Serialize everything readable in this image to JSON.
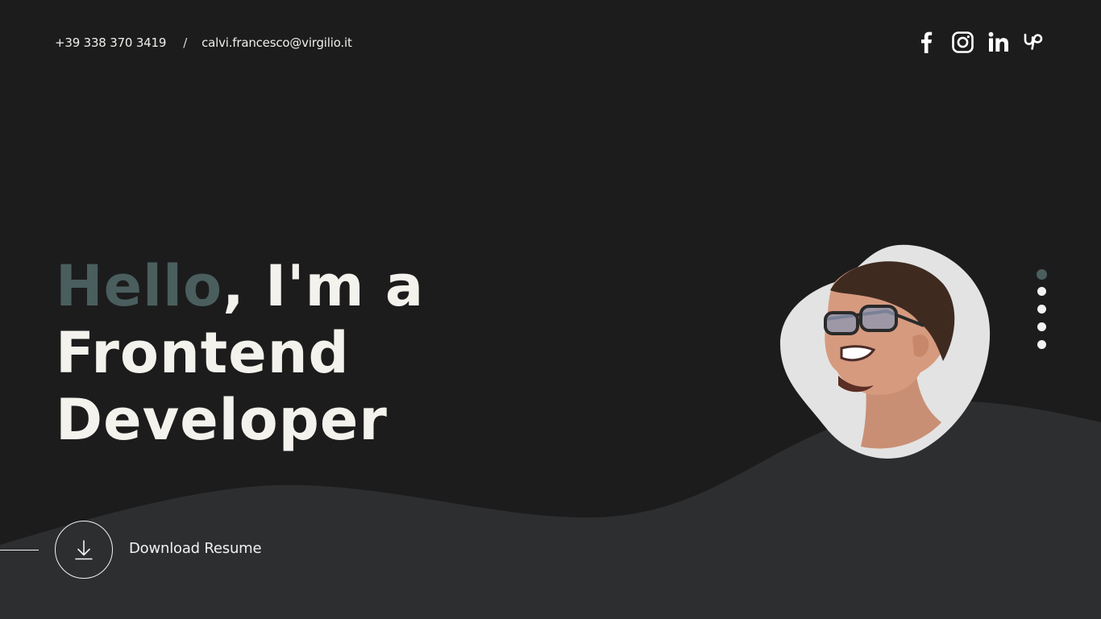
{
  "contact": {
    "phone": "+39 338 370 3419",
    "separator": "/",
    "email": "calvi.francesco@virgilio.it"
  },
  "social": [
    {
      "name": "facebook-icon"
    },
    {
      "name": "instagram-icon"
    },
    {
      "name": "linkedin-icon"
    },
    {
      "name": "upwork-icon"
    }
  ],
  "hero": {
    "hello": "Hello",
    "line1_rest": ", I'm a",
    "line2": "Frontend",
    "line3": "Developer"
  },
  "slide_nav": {
    "count": 5,
    "active_index": 0
  },
  "download": {
    "label": "Download Resume"
  },
  "colors": {
    "background": "#1c1c1d",
    "wave": "#2d2e30",
    "accent": "#4a5e5e",
    "text": "#f4f2ec"
  }
}
